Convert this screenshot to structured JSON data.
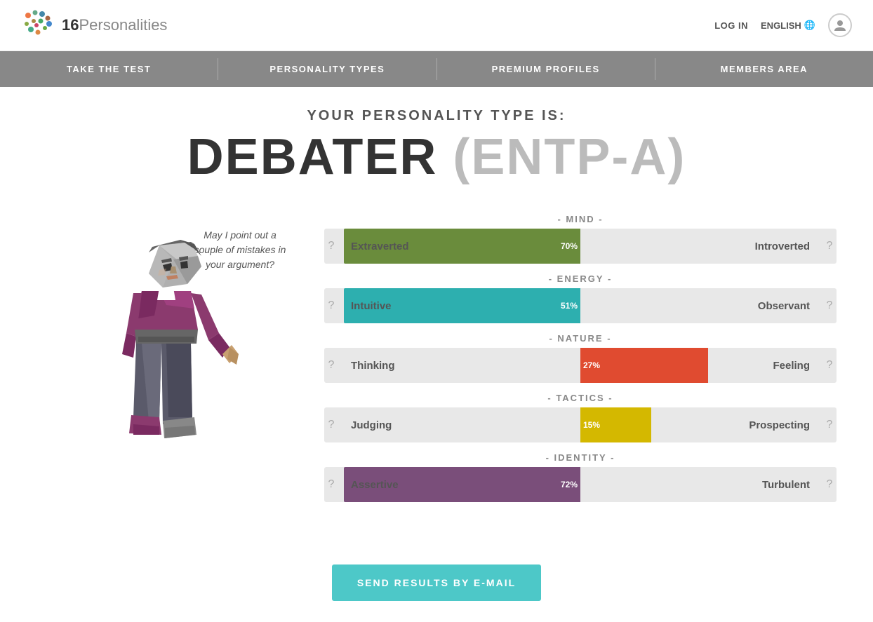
{
  "site": {
    "logo_text_bold": "16",
    "logo_text_light": "Personalities"
  },
  "header": {
    "login_label": "LOG IN",
    "language_label": "ENGLISH",
    "globe_icon": "🌐"
  },
  "nav": {
    "items": [
      {
        "label": "TAKE THE TEST",
        "id": "take-test"
      },
      {
        "label": "PERSONALITY TYPES",
        "id": "personality-types"
      },
      {
        "label": "PREMIUM PROFILES",
        "id": "premium-profiles"
      },
      {
        "label": "MEMBERS AREA",
        "id": "members-area"
      }
    ]
  },
  "result": {
    "subtitle": "YOUR PERSONALITY TYPE IS:",
    "name": "DEBATER",
    "code": "(ENTP-A)"
  },
  "character": {
    "quote": "May I point out a couple of mistakes in your argument?"
  },
  "traits": [
    {
      "category": "- MIND -",
      "left_label": "Extraverted",
      "right_label": "Introverted",
      "percent": 70,
      "direction": "left",
      "color": "#6a8c3c"
    },
    {
      "category": "- ENERGY -",
      "left_label": "Intuitive",
      "right_label": "Observant",
      "percent": 51,
      "direction": "left",
      "color": "#2dafaf"
    },
    {
      "category": "- NATURE -",
      "left_label": "Thinking",
      "right_label": "Feeling",
      "percent": 27,
      "direction": "right",
      "color": "#e04b30"
    },
    {
      "category": "- TACTICS -",
      "left_label": "Judging",
      "right_label": "Prospecting",
      "percent": 15,
      "direction": "right",
      "color": "#d4b800"
    },
    {
      "category": "- IDENTITY -",
      "left_label": "Assertive",
      "right_label": "Turbulent",
      "percent": 72,
      "direction": "left",
      "color": "#7a4e7a"
    }
  ],
  "send_button": "SEND RESULTS BY E-MAIL"
}
